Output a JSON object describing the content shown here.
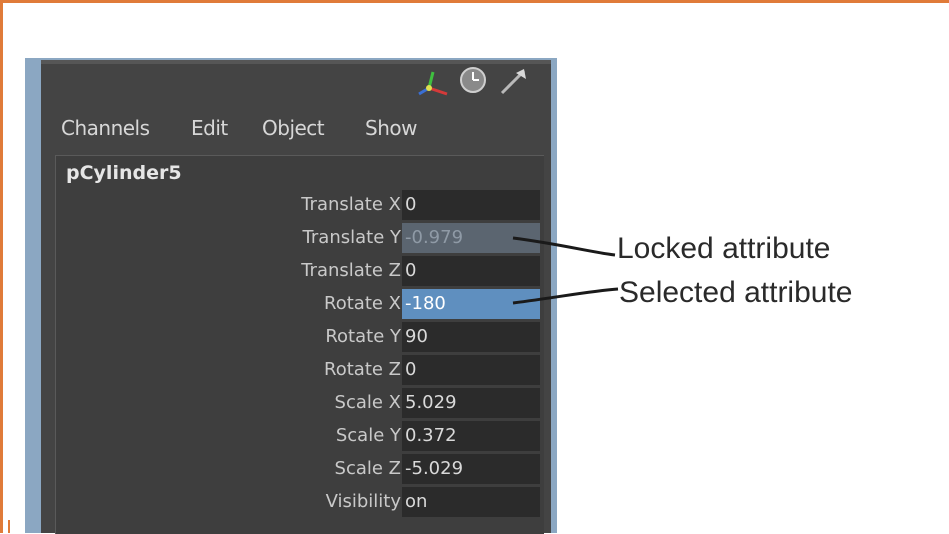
{
  "toolbar": {
    "icons": [
      "move-axes-icon",
      "clock-icon",
      "pick-arrow-icon"
    ]
  },
  "menu": {
    "items": [
      "Channels",
      "Edit",
      "Object",
      "Show"
    ]
  },
  "object_name": "pCylinder5",
  "attributes": [
    {
      "label": "Translate X",
      "value": "0",
      "state": "normal"
    },
    {
      "label": "Translate Y",
      "value": "-0.979",
      "state": "locked"
    },
    {
      "label": "Translate Z",
      "value": "0",
      "state": "normal"
    },
    {
      "label": "Rotate X",
      "value": "-180",
      "state": "selected"
    },
    {
      "label": "Rotate Y",
      "value": "90",
      "state": "normal"
    },
    {
      "label": "Rotate Z",
      "value": "0",
      "state": "normal"
    },
    {
      "label": "Scale X",
      "value": "5.029",
      "state": "normal"
    },
    {
      "label": "Scale Y",
      "value": "0.372",
      "state": "normal"
    },
    {
      "label": "Scale Z",
      "value": "-5.029",
      "state": "normal"
    },
    {
      "label": "Visibility",
      "value": "on",
      "state": "normal"
    }
  ],
  "annotations": {
    "locked": "Locked attribute",
    "selected": "Selected attribute"
  },
  "colors": {
    "frame": "#e07b39",
    "panel": "#444444",
    "locked_field": "#5b6570",
    "selected_field": "#5f8fbf"
  }
}
